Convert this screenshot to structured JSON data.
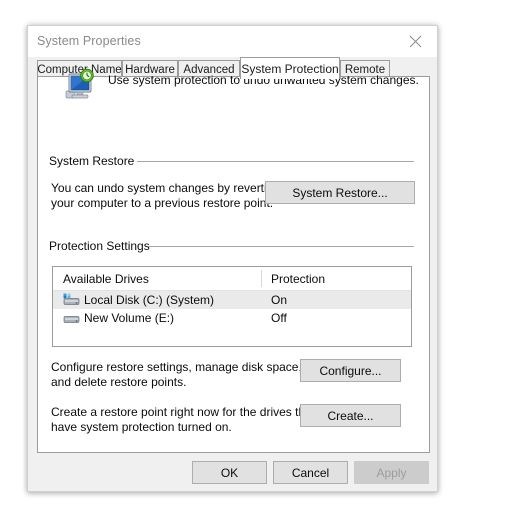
{
  "window": {
    "title": "System Properties",
    "close_label": "✕"
  },
  "tabs": [
    {
      "label": "Computer Name",
      "selected": false
    },
    {
      "label": "Hardware",
      "selected": false
    },
    {
      "label": "Advanced",
      "selected": false
    },
    {
      "label": "System Protection",
      "selected": true
    },
    {
      "label": "Remote",
      "selected": false
    }
  ],
  "banner": {
    "icon": "system-protection-icon",
    "text": "Use system protection to undo unwanted system changes."
  },
  "system_restore_group": {
    "label": "System Restore",
    "description_line1": "You can undo system changes by reverting",
    "description_line2": "your computer to a previous restore point.",
    "button_label": "System Restore..."
  },
  "protection_settings_group": {
    "label": "Protection Settings",
    "columns": [
      "Available Drives",
      "Protection"
    ],
    "rows": [
      {
        "icon": "system-drive-icon",
        "drive": "Local Disk (C:) (System)",
        "protection": "On",
        "selected": true
      },
      {
        "icon": "drive-icon",
        "drive": "New Volume (E:)",
        "protection": "Off",
        "selected": false
      }
    ],
    "configure_text_line1": "Configure restore settings, manage disk space,",
    "configure_text_line2": "and delete restore points.",
    "configure_button_label": "Configure...",
    "create_text_line1": "Create a restore point right now for the drives that",
    "create_text_line2": "have system protection turned on.",
    "create_button_label": "Create..."
  },
  "footer": {
    "ok_label": "OK",
    "cancel_label": "Cancel",
    "apply_label": "Apply",
    "apply_disabled": true
  },
  "colors": {
    "dialog_bg": "#f0f0f0",
    "page_bg": "#ffffff",
    "button_bg": "#e1e1e1",
    "selection_bg": "#eaeaea",
    "title_fg": "#8a8a8a",
    "text_fg": "#0b0b0b",
    "border": "#9c9c9c",
    "disabled_fg": "#9d9d9d"
  }
}
